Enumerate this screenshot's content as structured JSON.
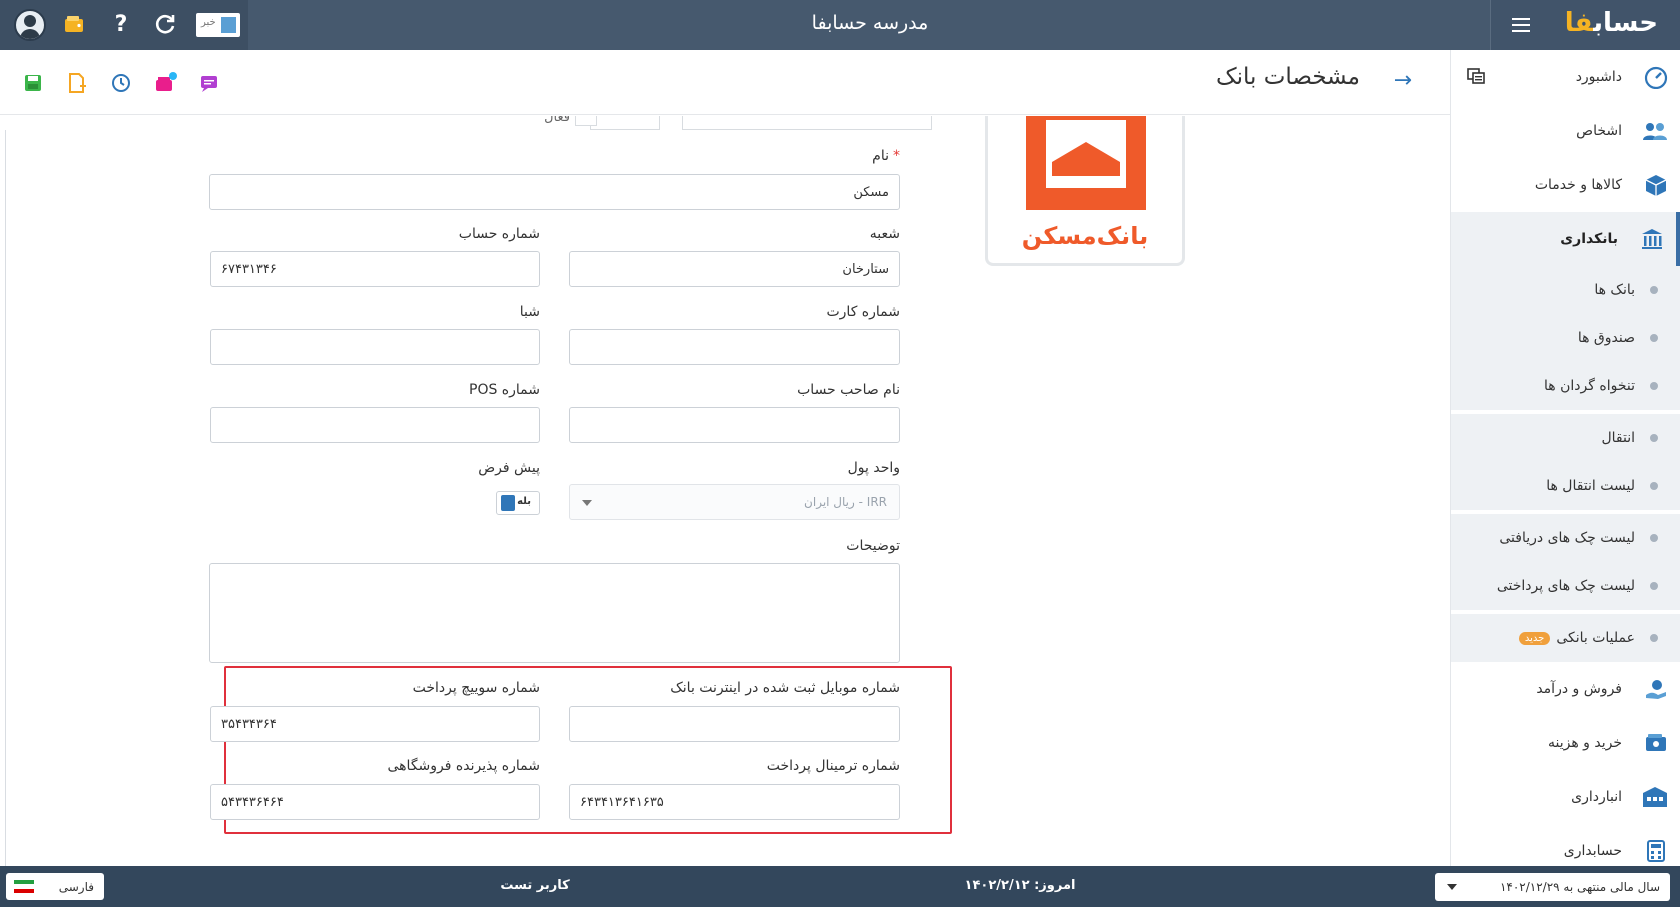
{
  "app": {
    "title": "مدرسه حسابفا",
    "brand_main": "حساب",
    "brand_accent": "فا",
    "news_label": "خبر",
    "accent_color": "#2f76b8",
    "topbar_color": "#46596e"
  },
  "page": {
    "title": "مشخصات بانک"
  },
  "sidebar": {
    "items": [
      {
        "label": "داشبورد",
        "icon": "dashboard-icon"
      },
      {
        "label": "اشخاص",
        "icon": "people-icon"
      },
      {
        "label": "کالاها و خدمات",
        "icon": "box-icon"
      },
      {
        "label": "بانکداری",
        "icon": "bank-icon"
      }
    ],
    "sub_items": [
      {
        "label": "بانک ها"
      },
      {
        "label": "صندوق ها"
      },
      {
        "label": "تنخواه گردان ها"
      },
      {
        "label": "انتقال"
      },
      {
        "label": "لیست انتقال ها"
      },
      {
        "label": "لیست چک های دریافتی"
      },
      {
        "label": "لیست چک های پرداختی"
      },
      {
        "label": "عملیات بانکی",
        "badge": "جدید"
      }
    ],
    "items_after": [
      {
        "label": "فروش و درآمد",
        "icon": "sales-icon"
      },
      {
        "label": "خرید و هزینه",
        "icon": "purchase-icon"
      },
      {
        "label": "انبارداری",
        "icon": "warehouse-icon"
      },
      {
        "label": "حسابداری",
        "icon": "accounting-icon"
      }
    ]
  },
  "bank": {
    "logo_name": "بانک‌مسکن",
    "logo_color": "#ef5a2a"
  },
  "form": {
    "name_label": "نام",
    "name_value": "مسکن",
    "branch_label": "شعبه",
    "branch_value": "ستارخان",
    "account_number_label": "شماره حساب",
    "account_number_value": "۶۷۴۳۱۳۴۶",
    "card_number_label": "شماره کارت",
    "card_number_value": "",
    "sheba_label": "شبا",
    "sheba_value": "",
    "account_holder_label": "نام صاحب حساب",
    "account_holder_value": "",
    "pos_label": "شماره POS",
    "pos_value": "",
    "currency_label": "واحد پول",
    "currency_value": "IRR - ریال ایران",
    "default_label": "پیش فرض",
    "default_value": "بله",
    "description_label": "توضیحات",
    "description_value": "",
    "mobile_label": "شماره موبایل ثبت شده در اینترنت بانک",
    "mobile_value": "",
    "switch_label": "شماره سوییچ پرداخت",
    "switch_value": "۳۵۴۳۴۳۶۴",
    "terminal_label": "شماره ترمینال پرداخت",
    "terminal_value": "۶۴۳۴۱۳۶۴۱۶۳۵",
    "merchant_label": "شماره پذیرنده فروشگاهی",
    "merchant_value": "۵۴۳۴۳۶۴۶۴",
    "active_label": "فعال"
  },
  "footer": {
    "language": "فارسی",
    "user": "کاربر تست",
    "today": "امروز: ۱۴۰۲/۲/۱۲",
    "fiscal_year": "سال مالی منتهی به ۱۴۰۲/۱۲/۲۹"
  }
}
